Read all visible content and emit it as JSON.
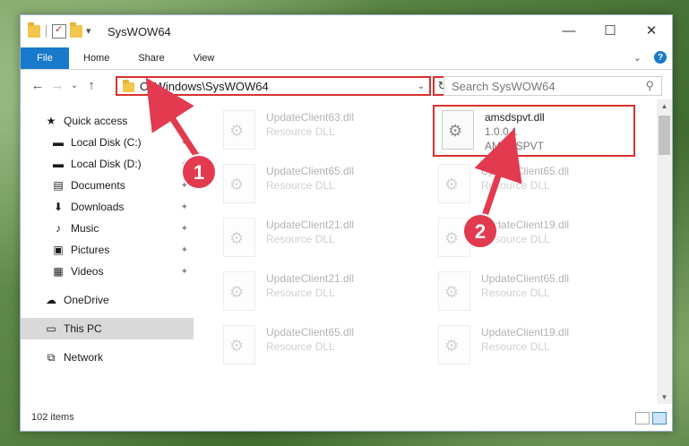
{
  "window": {
    "title": "SysWOW64",
    "minimize_glyph": "—",
    "maximize_glyph": "☐",
    "close_glyph": "✕"
  },
  "ribbon": {
    "tabs": [
      "File",
      "Home",
      "Share",
      "View"
    ],
    "expand_glyph": "⌄",
    "help_glyph": "?"
  },
  "nav": {
    "back_glyph": "←",
    "forward_glyph": "→",
    "recent_glyph": "⌄",
    "up_glyph": "↑"
  },
  "address": {
    "path": "C:\\Windows\\SysWOW64",
    "dropdown_glyph": "⌄",
    "refresh_glyph": "↻"
  },
  "search": {
    "placeholder": "Search SysWOW64",
    "icon_glyph": "⚲"
  },
  "sidebar": {
    "items": [
      {
        "label": "Quick access",
        "icon": "star-icon",
        "glyph": "★",
        "level": 1,
        "pinned": false
      },
      {
        "label": "Local Disk (C:)",
        "icon": "drive-icon",
        "glyph": "▬",
        "level": 2,
        "pinned": true
      },
      {
        "label": "Local Disk (D:)",
        "icon": "drive-icon",
        "glyph": "▬",
        "level": 2,
        "pinned": true
      },
      {
        "label": "Documents",
        "icon": "documents-icon",
        "glyph": "▤",
        "level": 2,
        "pinned": true
      },
      {
        "label": "Downloads",
        "icon": "download-icon",
        "glyph": "⬇",
        "level": 2,
        "pinned": true
      },
      {
        "label": "Music",
        "icon": "music-icon",
        "glyph": "♪",
        "level": 2,
        "pinned": true
      },
      {
        "label": "Pictures",
        "icon": "pictures-icon",
        "glyph": "▣",
        "level": 2,
        "pinned": true
      },
      {
        "label": "Videos",
        "icon": "videos-icon",
        "glyph": "▦",
        "level": 2,
        "pinned": true
      },
      {
        "label": "OneDrive",
        "icon": "cloud-icon",
        "glyph": "☁",
        "level": 1,
        "pinned": false
      },
      {
        "label": "This PC",
        "icon": "computer-icon",
        "glyph": "▭",
        "level": 1,
        "pinned": false
      },
      {
        "label": "Network",
        "icon": "network-icon",
        "glyph": "⧉",
        "level": 1,
        "pinned": false
      }
    ],
    "pin_glyph": "📌"
  },
  "files": [
    {
      "name": "UpdateClient63.dll",
      "line2": "Resource DLL",
      "line3": "",
      "faded": true
    },
    {
      "name": "amsdspvt.dll",
      "line2": "1.0.0.1",
      "line3": "AMSDSPVT",
      "faded": false,
      "highlighted": true
    },
    {
      "name": "UpdateClient65.dll",
      "line2": "Resource DLL",
      "line3": "",
      "faded": true
    },
    {
      "name": "UpdateClient65.dll",
      "line2": "Resource DLL",
      "line3": "",
      "faded": true
    },
    {
      "name": "UpdateClient21.dll",
      "line2": "Resource DLL",
      "line3": "",
      "faded": true
    },
    {
      "name": "UpdateClient19.dll",
      "line2": "Resource DLL",
      "line3": "",
      "faded": true
    },
    {
      "name": "UpdateClient21.dll",
      "line2": "Resource DLL",
      "line3": "",
      "faded": true
    },
    {
      "name": "UpdateClient65.dll",
      "line2": "Resource DLL",
      "line3": "",
      "faded": true
    },
    {
      "name": "UpdateClient65.dll",
      "line2": "Resource DLL",
      "line3": "",
      "faded": true
    },
    {
      "name": "UpdateClient19.dll",
      "line2": "Resource DLL",
      "line3": "",
      "faded": true
    }
  ],
  "status": {
    "item_count": "102 items"
  },
  "annotations": {
    "badge1": "1",
    "badge2": "2",
    "accent_color": "#d9312c"
  },
  "colors": {
    "file_tab": "#1979ca",
    "selected_nav": "#d9d9d9",
    "highlight": "#d9312c"
  }
}
